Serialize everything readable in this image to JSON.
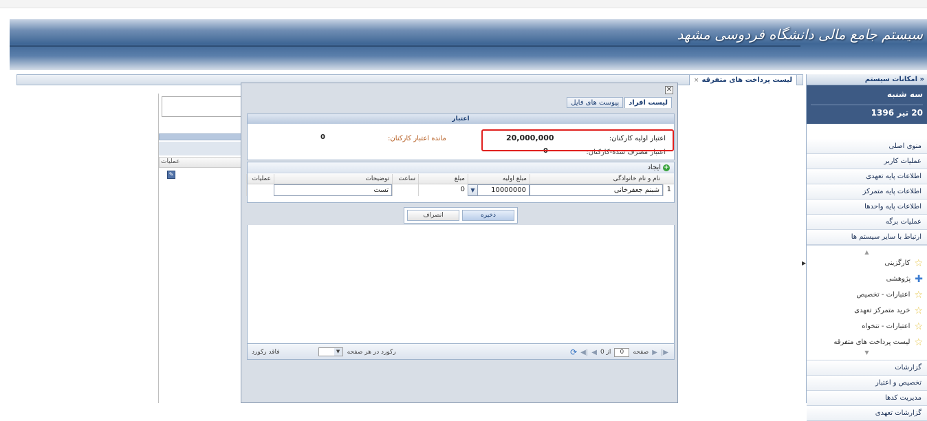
{
  "banner": {
    "title": "سیستم جامع مالی دانشگاه فردوسی مشهد"
  },
  "tabs": {
    "active_label": "لیست پرداخت های متفرقه",
    "close_glyph": "×"
  },
  "sidebar": {
    "header": "امکانات سیستم",
    "day": "سه شنبه",
    "date": "20 تیر 1396",
    "menu_top": [
      "منوی اصلی",
      "عملیات کاربر",
      "اطلاعات پایه تعهدی",
      "اطلاعات پایه متمرکز",
      "اطلاعات پایه واحدها",
      "عملیات برگه",
      "ارتباط با سایر سیستم ها"
    ],
    "favorites": [
      {
        "label": "کارگزینی",
        "icon": "star-icon"
      },
      {
        "label": "پژوهشی",
        "icon": "plus-icon"
      },
      {
        "label": "اعتبارات - تخصیص",
        "icon": "star-icon"
      },
      {
        "label": "خرید متمرکز تعهدی",
        "icon": "star-icon"
      },
      {
        "label": "اعتبارات - تنخواه",
        "icon": "star-icon"
      },
      {
        "label": "لیست پرداخت های متفرقه",
        "icon": "star-icon"
      }
    ],
    "menu_bottom": [
      "گزارشات",
      "تخصیص و اعتبار",
      "مدیریت کدها",
      "گزارشات تعهدی"
    ]
  },
  "left_panel": {
    "header": "عملیات"
  },
  "dialog": {
    "tabs": [
      "لیست افراد",
      "پیوست های فایل"
    ],
    "credit": {
      "title": "اعتبار",
      "initial_label": "اعتبار اولیه کارکنان:",
      "initial_value": "20,000,000",
      "remaining_label": "مانده اعتبار کارکنان:",
      "remaining_value": "0",
      "used_label": "اعتبار مصرف شده-کارکنان:",
      "used_value": "0"
    },
    "grid": {
      "add_label": "ایجاد",
      "columns": [
        "نام و نام خانوادگی",
        "مبلغ اولیه",
        "مبلغ",
        "ساعت",
        "توضیحات",
        "عملیات"
      ],
      "row": {
        "index": "1",
        "name": "شبنم جعفرخانی",
        "initial_amount": "10000000",
        "amount": "0",
        "hour": "",
        "description": "تست"
      }
    },
    "buttons": {
      "save": "ذخیره",
      "cancel": "انصراف"
    },
    "pager": {
      "page_label": "صفحه",
      "page_value": "0",
      "of_label": "از 0",
      "no_record": "فاقد رکورد",
      "per_page_label": "رکورد در هر صفحه"
    }
  }
}
